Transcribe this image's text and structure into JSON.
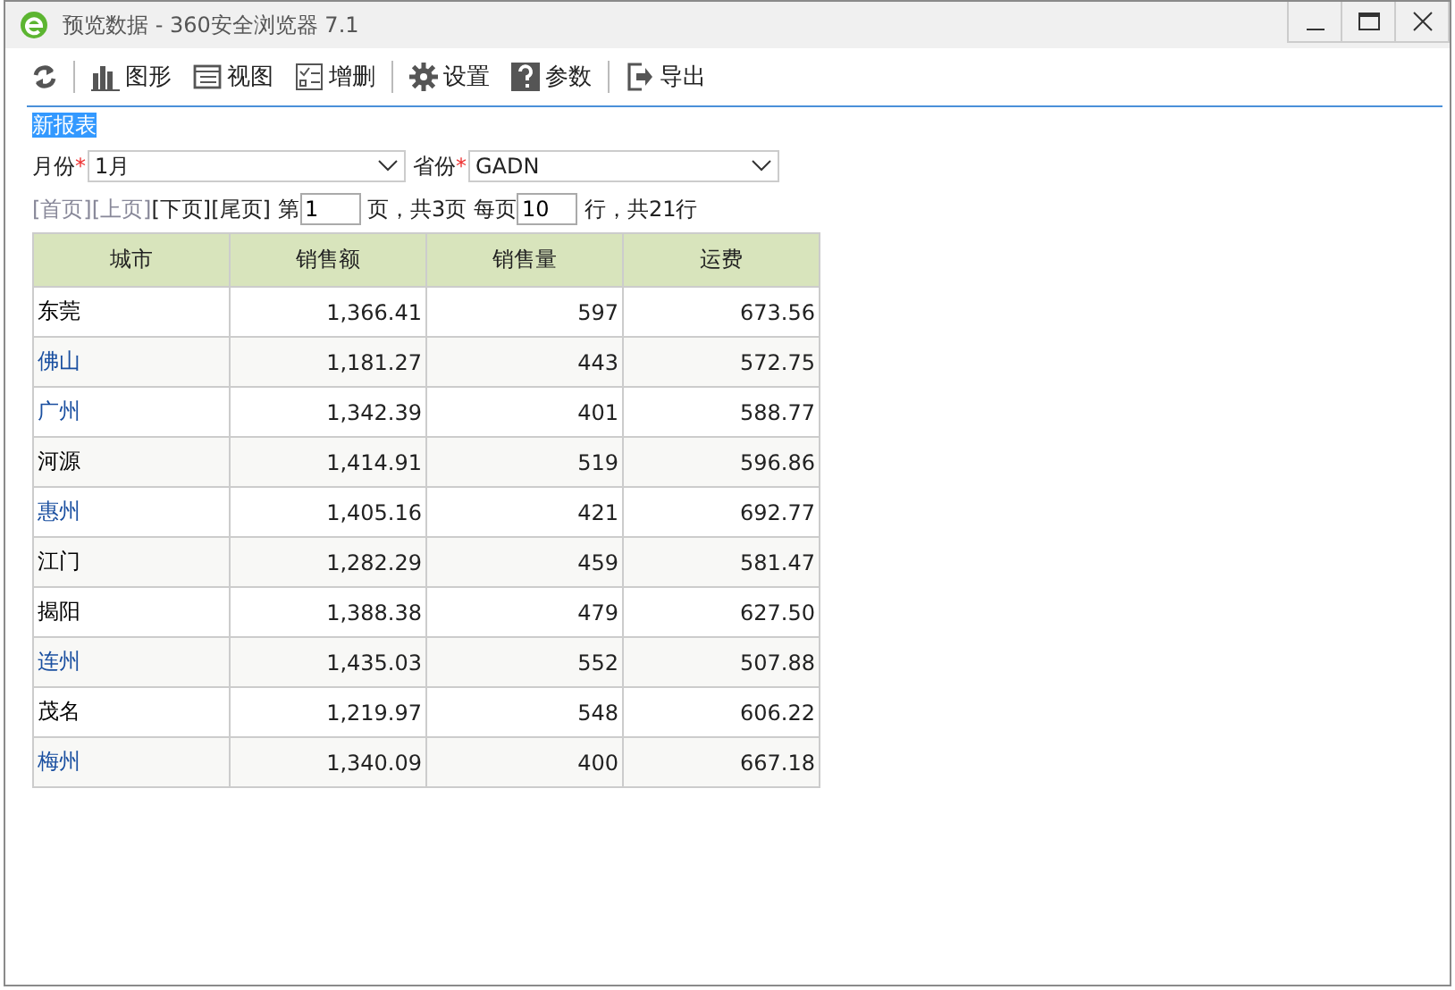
{
  "window": {
    "title": "预览数据 - 360安全浏览器 7.1"
  },
  "toolbar": [
    {
      "kind": "refresh"
    },
    {
      "kind": "chart",
      "label": "图形"
    },
    {
      "kind": "view",
      "label": "视图"
    },
    {
      "kind": "edit",
      "label": "增删"
    },
    {
      "kind": "settings",
      "label": "设置"
    },
    {
      "kind": "params",
      "label": "参数"
    },
    {
      "kind": "export",
      "label": "导出"
    }
  ],
  "report_title": "新报表",
  "filters": [
    {
      "label": "月份",
      "required_mark": "*",
      "value": "1月"
    },
    {
      "label": "省份",
      "required_mark": "*",
      "value": "GADN"
    }
  ],
  "pager": {
    "links": [
      {
        "label": "[首页]",
        "disabled": true
      },
      {
        "label": "[上页]",
        "disabled": true
      },
      {
        "label": "[下页]",
        "disabled": false
      },
      {
        "label": "[尾页]",
        "disabled": false
      }
    ],
    "page_prefix": "第",
    "page": "1",
    "page_suffix": "页，共3页 每页",
    "per_page": "10",
    "per_page_suffix": "行，共21行"
  },
  "table": {
    "columns": [
      "城市",
      "销售额",
      "销售量",
      "运费"
    ],
    "rows": [
      {
        "city": "东莞",
        "color": "#000000",
        "values": [
          "1,366.41",
          "597",
          "673.56"
        ]
      },
      {
        "city": "佛山",
        "color": "#1a4fa0",
        "values": [
          "1,181.27",
          "443",
          "572.75"
        ]
      },
      {
        "city": "广州",
        "color": "#1a4fa0",
        "values": [
          "1,342.39",
          "401",
          "588.77"
        ]
      },
      {
        "city": "河源",
        "color": "#000000",
        "values": [
          "1,414.91",
          "519",
          "596.86"
        ]
      },
      {
        "city": "惠州",
        "color": "#1a4fa0",
        "values": [
          "1,405.16",
          "421",
          "692.77"
        ]
      },
      {
        "city": "江门",
        "color": "#000000",
        "values": [
          "1,282.29",
          "459",
          "581.47"
        ]
      },
      {
        "city": "揭阳",
        "color": "#000000",
        "values": [
          "1,388.38",
          "479",
          "627.50"
        ]
      },
      {
        "city": "连州",
        "color": "#1a4fa0",
        "values": [
          "1,435.03",
          "552",
          "507.88"
        ]
      },
      {
        "city": "茂名",
        "color": "#000000",
        "values": [
          "1,219.97",
          "548",
          "606.22"
        ]
      },
      {
        "city": "梅州",
        "color": "#1a4fa0",
        "values": [
          "1,340.09",
          "400",
          "667.18"
        ]
      }
    ]
  }
}
